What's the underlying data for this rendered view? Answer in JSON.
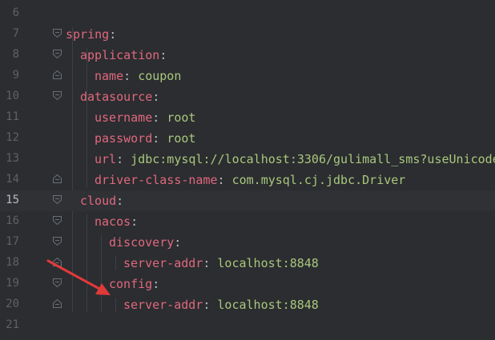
{
  "editor": {
    "lines": [
      {
        "num": "6",
        "indent": 0,
        "key": "",
        "value": "",
        "fold": "",
        "current": false
      },
      {
        "num": "7",
        "indent": 0,
        "key": "spring",
        "value": "",
        "fold": "open",
        "current": false
      },
      {
        "num": "8",
        "indent": 1,
        "key": "application",
        "value": "",
        "fold": "open",
        "current": false
      },
      {
        "num": "9",
        "indent": 2,
        "key": "name",
        "value": "coupon",
        "fold": "end",
        "current": false
      },
      {
        "num": "10",
        "indent": 1,
        "key": "datasource",
        "value": "",
        "fold": "open",
        "current": false
      },
      {
        "num": "11",
        "indent": 2,
        "key": "username",
        "value": "root",
        "fold": "",
        "current": false
      },
      {
        "num": "12",
        "indent": 2,
        "key": "password",
        "value": "root",
        "fold": "",
        "current": false
      },
      {
        "num": "13",
        "indent": 2,
        "key": "url",
        "value": "jdbc:mysql://localhost:3306/gulimall_sms?useUnicode",
        "fold": "",
        "current": false
      },
      {
        "num": "14",
        "indent": 2,
        "key": "driver-class-name",
        "value": "com.mysql.cj.jdbc.Driver",
        "fold": "end",
        "current": false
      },
      {
        "num": "15",
        "indent": 1,
        "key": "cloud",
        "value": "",
        "fold": "open",
        "current": true
      },
      {
        "num": "16",
        "indent": 2,
        "key": "nacos",
        "value": "",
        "fold": "open",
        "current": false
      },
      {
        "num": "17",
        "indent": 3,
        "key": "discovery",
        "value": "",
        "fold": "open",
        "current": false
      },
      {
        "num": "18",
        "indent": 4,
        "key": "server-addr",
        "value": "localhost:8848",
        "fold": "end",
        "current": false
      },
      {
        "num": "19",
        "indent": 3,
        "key": "config",
        "value": "",
        "fold": "open",
        "current": false
      },
      {
        "num": "20",
        "indent": 4,
        "key": "server-addr",
        "value": "localhost:8848",
        "fold": "end",
        "current": false
      },
      {
        "num": "21",
        "indent": 0,
        "key": "",
        "value": "",
        "fold": "",
        "current": false
      }
    ]
  },
  "colors": {
    "background": "#2b2d30",
    "key": "#e0687e",
    "value": "#a9c77d",
    "arrow": "#e03a3a"
  },
  "annotation": {
    "type": "arrow",
    "icon": "red-arrow-icon"
  }
}
